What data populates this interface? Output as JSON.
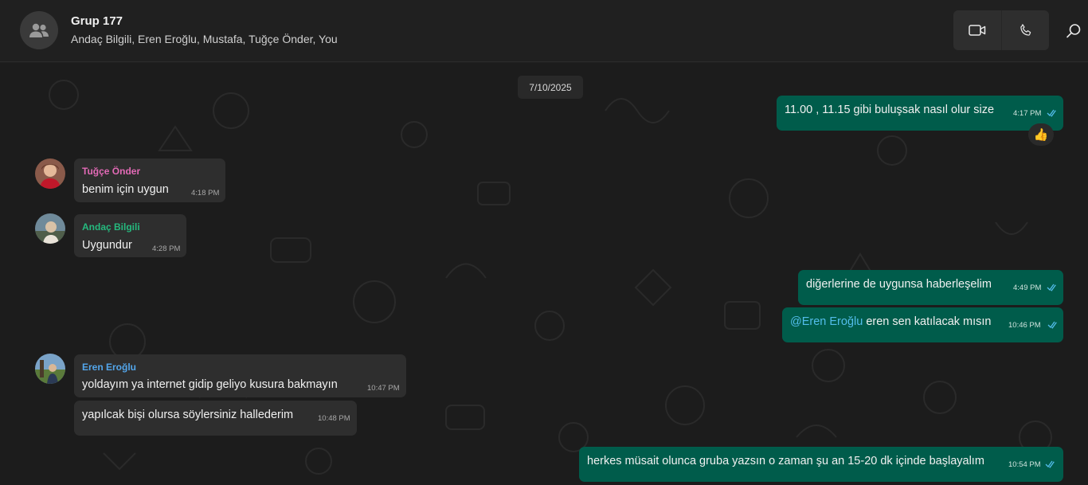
{
  "header": {
    "group_name": "Grup 177",
    "members": "Andaç Bilgili, Eren Eroğlu, Mustafa, Tuğçe Önder, You",
    "avatar_icon": "group-icon",
    "video_icon": "video-call-icon",
    "voice_icon": "phone-icon",
    "search_icon": "search-icon"
  },
  "chat": {
    "date": "7/10/2025",
    "messages": [
      {
        "direction": "out",
        "text": "11.00 , 11.15 gibi buluşsak nasıl olur size",
        "time": "4:17 PM",
        "reaction": "👍",
        "status": "read-ticks-icon"
      },
      {
        "direction": "in",
        "sender": "Tuğçe Önder",
        "sender_color": "#e26ab6",
        "text": "benim için uygun",
        "time": "4:18 PM"
      },
      {
        "direction": "in",
        "sender": "Andaç Bilgili",
        "sender_color": "#25b97e",
        "text": "Uygundur",
        "time": "4:28 PM"
      },
      {
        "direction": "out",
        "text": "diğerlerine de uygunsa haberleşelim",
        "time": "4:49 PM",
        "status": "read-ticks-icon"
      },
      {
        "direction": "out",
        "mention": "@Eren Eroğlu",
        "text": " eren sen katılacak mısın",
        "time": "10:46 PM",
        "status": "read-ticks-icon"
      },
      {
        "direction": "in",
        "sender": "Eren Eroğlu",
        "sender_color": "#53a6eb",
        "text": "yoldayım ya internet gidip geliyo kusura bakmayın",
        "time": "10:47 PM"
      },
      {
        "direction": "in",
        "text": "yapılcak bişi olursa söylersiniz hallederim",
        "time": "10:48 PM"
      },
      {
        "direction": "out",
        "text": "herkes müsait olunca gruba yazsın o zaman şu an 15-20 dk içinde başlayalım",
        "time": "10:54 PM",
        "status": "read-ticks-icon"
      }
    ]
  },
  "colors": {
    "outgoing_bubble": "#005c4b",
    "incoming_bubble": "#2e2e2e",
    "background": "#1c1c1c",
    "header": "#202020",
    "read_ticks": "#53bdeb"
  }
}
